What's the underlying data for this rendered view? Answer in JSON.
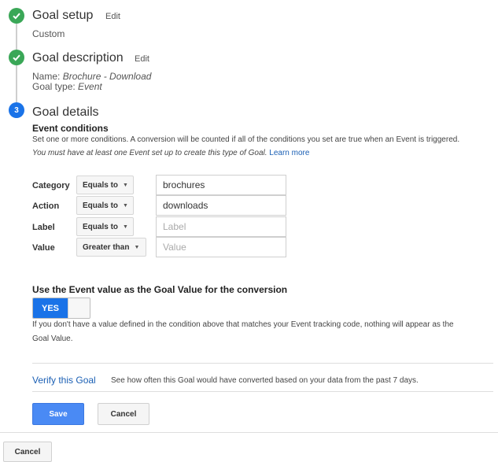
{
  "steps": {
    "setup": {
      "title": "Goal setup",
      "edit": "Edit",
      "value": "Custom"
    },
    "description": {
      "title": "Goal description",
      "edit": "Edit",
      "name_label": "Name:",
      "name_value": "Brochure - Download",
      "type_label": "Goal type:",
      "type_value": "Event"
    },
    "details": {
      "number": "3",
      "title": "Goal details"
    }
  },
  "event_conditions": {
    "heading": "Event conditions",
    "description": "Set one or more conditions. A conversion will be counted if all of the conditions you set are true when an Event is triggered.",
    "requirement": "You must have at least one Event set up to create this type of Goal.",
    "learn_more": "Learn more",
    "rows": [
      {
        "label": "Category",
        "operator": "Equals to",
        "value": "brochures",
        "placeholder": ""
      },
      {
        "label": "Action",
        "operator": "Equals to",
        "value": "downloads",
        "placeholder": ""
      },
      {
        "label": "Label",
        "operator": "Equals to",
        "value": "",
        "placeholder": "Label"
      },
      {
        "label": "Value",
        "operator": "Greater than",
        "value": "",
        "placeholder": "Value"
      }
    ]
  },
  "goal_value": {
    "heading": "Use the Event value as the Goal Value for the conversion",
    "toggle_label": "YES",
    "toggle_on": true,
    "note_line1": "If you don't have a value defined in the condition above that matches your Event tracking code, nothing will appear as the",
    "note_line2": "Goal Value."
  },
  "verify": {
    "link": "Verify this Goal",
    "description": "See how often this Goal would have converted based on your data from the past 7 days."
  },
  "buttons": {
    "save": "Save",
    "cancel": "Cancel",
    "outer_cancel": "Cancel"
  },
  "colors": {
    "done": "#3aa757",
    "active": "#1a73e8",
    "primary": "#4a8af4",
    "link": "#1a5fb4"
  }
}
